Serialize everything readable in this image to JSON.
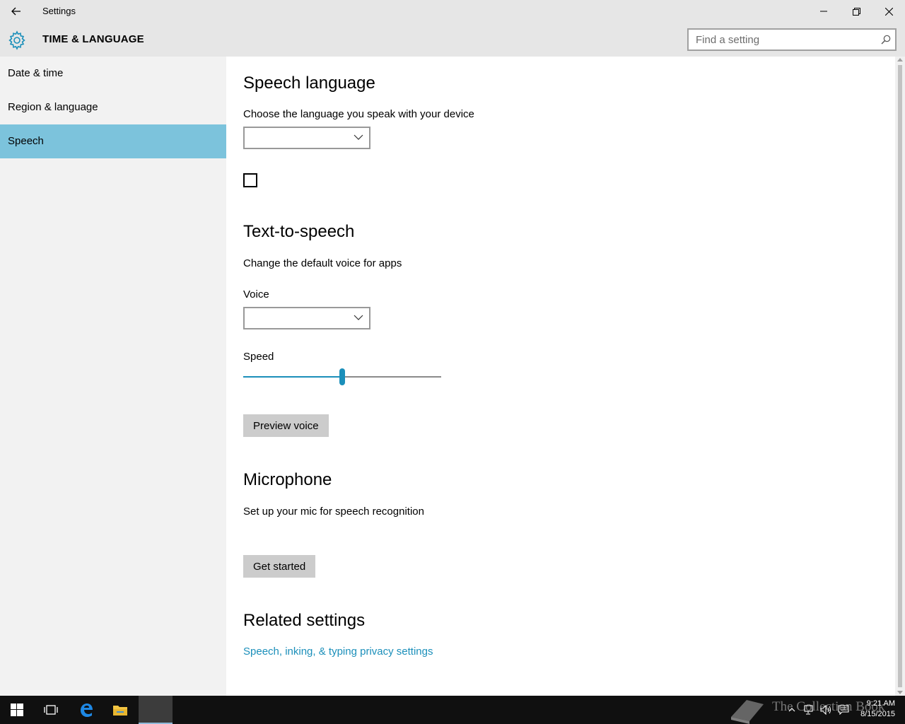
{
  "window": {
    "title": "Settings",
    "minimize_icon": "minimize-icon",
    "maximize_icon": "restore-icon",
    "close_icon": "close-icon"
  },
  "header": {
    "section_title": "TIME & LANGUAGE",
    "icon": "gear-icon"
  },
  "search": {
    "placeholder": "Find a setting",
    "value": ""
  },
  "sidebar": {
    "items": [
      {
        "label": "Date & time",
        "active": false
      },
      {
        "label": "Region & language",
        "active": false
      },
      {
        "label": "Speech",
        "active": true
      }
    ]
  },
  "main": {
    "speech_language": {
      "heading": "Speech language",
      "description": "Choose the language you speak with your device",
      "dropdown_value": "",
      "checkbox_checked": false
    },
    "text_to_speech": {
      "heading": "Text-to-speech",
      "description": "Change the default voice for apps",
      "voice_label": "Voice",
      "voice_value": "",
      "speed_label": "Speed",
      "speed_fraction": 0.5,
      "preview_button": "Preview voice"
    },
    "microphone": {
      "heading": "Microphone",
      "description": "Set up your mic for speech recognition",
      "button": "Get started"
    },
    "related": {
      "heading": "Related settings",
      "link": "Speech, inking, & typing privacy settings"
    }
  },
  "taskbar": {
    "time": "9:21 AM",
    "date": "8/15/2015",
    "watermark": "The Collection Book"
  },
  "colors": {
    "accent": "#1b8fba",
    "sidebar_active": "#7cc3dc",
    "chrome": "#e6e6e6",
    "sidebar_bg": "#f2f2f2",
    "taskbar_bg": "#101010"
  }
}
